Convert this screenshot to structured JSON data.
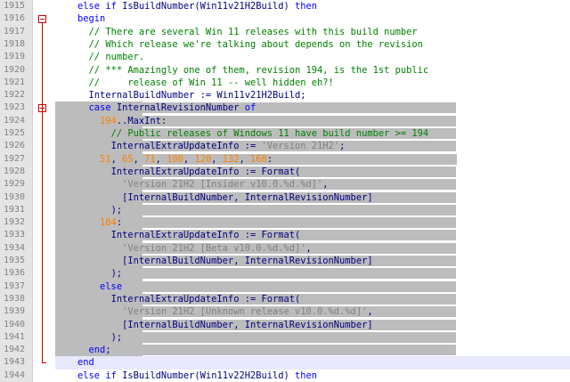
{
  "editor": {
    "lines": [
      {
        "n": "1915",
        "tokens": [
          [
            "    ",
            ""
          ],
          [
            "else",
            "kw"
          ],
          [
            " ",
            ""
          ],
          [
            "if",
            "kw"
          ],
          [
            " IsBuildNumber(Win11v21H2Build) ",
            "ident"
          ],
          [
            "then",
            "kw"
          ]
        ]
      },
      {
        "n": "1916",
        "tokens": [
          [
            "    ",
            ""
          ],
          [
            "begin",
            "kw"
          ]
        ]
      },
      {
        "n": "1917",
        "tokens": [
          [
            "      ",
            ""
          ],
          [
            "// There are several Win 11 releases with this build number",
            "cmt"
          ]
        ]
      },
      {
        "n": "1918",
        "tokens": [
          [
            "      ",
            ""
          ],
          [
            "// Which release we're talking about depends on the revision",
            "cmt"
          ]
        ]
      },
      {
        "n": "1919",
        "tokens": [
          [
            "      ",
            ""
          ],
          [
            "// number.",
            "cmt"
          ]
        ]
      },
      {
        "n": "1920",
        "tokens": [
          [
            "      ",
            ""
          ],
          [
            "// *** Amazingly one of them, revision 194, is the 1st public",
            "cmt"
          ]
        ]
      },
      {
        "n": "1921",
        "tokens": [
          [
            "      ",
            ""
          ],
          [
            "//     release of Win 11 -- well hidden eh?!",
            "cmt"
          ]
        ]
      },
      {
        "n": "1922",
        "tokens": [
          [
            "      ",
            ""
          ],
          [
            "InternalBuildNumber := Win11v21H2Build;",
            "ident"
          ]
        ]
      },
      {
        "n": "1923",
        "tokens": [
          [
            "      ",
            ""
          ],
          [
            "case",
            "kw"
          ],
          [
            " InternalRevisionNumber ",
            "ident"
          ],
          [
            "of",
            "kw"
          ]
        ]
      },
      {
        "n": "1924",
        "tokens": [
          [
            "        ",
            ""
          ],
          [
            "194",
            "num"
          ],
          [
            "..MaxInt:",
            "ident"
          ]
        ]
      },
      {
        "n": "1925",
        "tokens": [
          [
            "          ",
            ""
          ],
          [
            "// Public releases of Windows 11 have build number >= 194",
            "cmt"
          ]
        ]
      },
      {
        "n": "1926",
        "tokens": [
          [
            "          ",
            ""
          ],
          [
            "InternalExtraUpdateInfo := ",
            "ident"
          ],
          [
            "'Version 21H2'",
            "str"
          ],
          [
            ";",
            "ident"
          ]
        ]
      },
      {
        "n": "1927",
        "tokens": [
          [
            "        ",
            ""
          ],
          [
            "51",
            "num"
          ],
          [
            ", ",
            "ident"
          ],
          [
            "65",
            "num"
          ],
          [
            ", ",
            "ident"
          ],
          [
            "71",
            "num"
          ],
          [
            ", ",
            "ident"
          ],
          [
            "100",
            "num"
          ],
          [
            ", ",
            "ident"
          ],
          [
            "120",
            "num"
          ],
          [
            ", ",
            "ident"
          ],
          [
            "132",
            "num"
          ],
          [
            ", ",
            "ident"
          ],
          [
            "168",
            "num"
          ],
          [
            ":",
            "ident"
          ]
        ]
      },
      {
        "n": "1928",
        "tokens": [
          [
            "          ",
            ""
          ],
          [
            "InternalExtraUpdateInfo := Format(",
            "ident"
          ]
        ]
      },
      {
        "n": "1929",
        "tokens": [
          [
            "            ",
            ""
          ],
          [
            "'Version 21H2 [Insider v10.0.%d.%d]'",
            "str"
          ],
          [
            ",",
            "ident"
          ]
        ]
      },
      {
        "n": "1930",
        "tokens": [
          [
            "            ",
            ""
          ],
          [
            "[InternalBuildNumber, InternalRevisionNumber]",
            "ident"
          ]
        ]
      },
      {
        "n": "1931",
        "tokens": [
          [
            "          ",
            ""
          ],
          [
            ");",
            "ident"
          ]
        ]
      },
      {
        "n": "1932",
        "tokens": [
          [
            "        ",
            ""
          ],
          [
            "184",
            "num"
          ],
          [
            ":",
            "ident"
          ]
        ]
      },
      {
        "n": "1933",
        "tokens": [
          [
            "          ",
            ""
          ],
          [
            "InternalExtraUpdateInfo := Format(",
            "ident"
          ]
        ]
      },
      {
        "n": "1934",
        "tokens": [
          [
            "            ",
            ""
          ],
          [
            "'Version 21H2 [Beta v10.0.%d.%d]'",
            "str"
          ],
          [
            ",",
            "ident"
          ]
        ]
      },
      {
        "n": "1935",
        "tokens": [
          [
            "            ",
            ""
          ],
          [
            "[InternalBuildNumber, InternalRevisionNumber]",
            "ident"
          ]
        ]
      },
      {
        "n": "1936",
        "tokens": [
          [
            "          ",
            ""
          ],
          [
            ");",
            "ident"
          ]
        ]
      },
      {
        "n": "1937",
        "tokens": [
          [
            "        ",
            ""
          ],
          [
            "else",
            "kw"
          ]
        ]
      },
      {
        "n": "1938",
        "tokens": [
          [
            "          ",
            ""
          ],
          [
            "InternalExtraUpdateInfo := Format(",
            "ident"
          ]
        ]
      },
      {
        "n": "1939",
        "tokens": [
          [
            "            ",
            ""
          ],
          [
            "'Version 21H2 [Unknown release v10.0.%d.%d]'",
            "str"
          ],
          [
            ",",
            "ident"
          ]
        ]
      },
      {
        "n": "1940",
        "tokens": [
          [
            "            ",
            ""
          ],
          [
            "[InternalBuildNumber, InternalRevisionNumber]",
            "ident"
          ]
        ]
      },
      {
        "n": "1941",
        "tokens": [
          [
            "          ",
            ""
          ],
          [
            ");",
            "ident"
          ]
        ]
      },
      {
        "n": "1942",
        "tokens": [
          [
            "      ",
            ""
          ],
          [
            "end",
            "kw"
          ],
          [
            ";",
            "ident"
          ]
        ]
      },
      {
        "n": "1943",
        "tokens": [
          [
            "    ",
            ""
          ],
          [
            "end",
            "kw"
          ]
        ]
      },
      {
        "n": "1944",
        "tokens": [
          [
            "    ",
            ""
          ],
          [
            "else",
            "kw"
          ],
          [
            " ",
            ""
          ],
          [
            "if",
            "kw"
          ],
          [
            " IsBuildNumber(Win11v22H2Build) ",
            "ident"
          ],
          [
            "then",
            "kw"
          ]
        ]
      }
    ]
  },
  "colors": {
    "keyword": "#0000ff",
    "comment": "#008000",
    "string": "#808080",
    "number": "#ff8000",
    "identifier": "#000080",
    "selection": "#bcbcbc",
    "current_line": "#e8e8ff",
    "fold_marker": "#cc0000"
  }
}
